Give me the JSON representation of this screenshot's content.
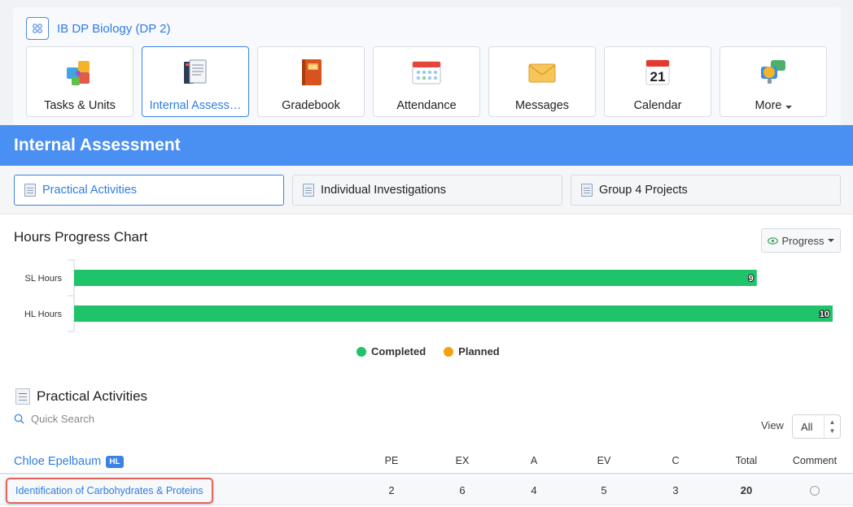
{
  "course": {
    "title": "IB DP Biology (DP 2)",
    "icon": "grid-icon"
  },
  "tiles": [
    {
      "label": "Tasks & Units",
      "icon": "puzzle-icon",
      "active": false
    },
    {
      "label": "Internal Assess…",
      "icon": "notebook-icon",
      "active": true
    },
    {
      "label": "Gradebook",
      "icon": "gradebook-icon",
      "active": false
    },
    {
      "label": "Attendance",
      "icon": "attendance-icon",
      "active": false
    },
    {
      "label": "Messages",
      "icon": "envelope-icon",
      "active": false
    },
    {
      "label": "Calendar",
      "icon": "calendar-icon",
      "calendar_day": "21",
      "active": false
    },
    {
      "label": "More",
      "icon": "chat-bubbles-icon",
      "active": false
    }
  ],
  "section": {
    "title": "Internal Assessment"
  },
  "subtabs": [
    {
      "label": "Practical Activities",
      "active": true
    },
    {
      "label": "Individual Investigations",
      "active": false
    },
    {
      "label": "Group 4 Projects",
      "active": false
    }
  ],
  "chart_section": {
    "title": "Hours Progress Chart",
    "toggle_label": "Progress",
    "toggle_icon": "eye-icon"
  },
  "chart_data": {
    "type": "bar",
    "orientation": "horizontal",
    "categories": [
      "SL Hours",
      "HL Hours"
    ],
    "series": [
      {
        "name": "Completed",
        "values": [
          9,
          10
        ],
        "color": "#1fc46a"
      },
      {
        "name": "Planned",
        "values": [
          0,
          0
        ],
        "color": "#f0a30a"
      }
    ],
    "xlim": [
      0,
      10
    ],
    "legend_position": "bottom"
  },
  "activities": {
    "title": "Practical Activities",
    "search_placeholder": "Quick Search",
    "view_label": "View",
    "view_value": "All",
    "student": {
      "name": "Chloe Epelbaum",
      "level": "HL"
    },
    "columns": [
      "PE",
      "EX",
      "A",
      "EV",
      "C",
      "Total",
      "Comment"
    ],
    "rows": [
      {
        "name": "Identification of Carbohydrates & Proteins",
        "PE": "2",
        "EX": "6",
        "A": "4",
        "EV": "5",
        "C": "3",
        "Total": "20"
      }
    ]
  },
  "colors": {
    "accent": "#4a8ff2",
    "link": "#2f7de1",
    "highlight": "#e0655a"
  }
}
